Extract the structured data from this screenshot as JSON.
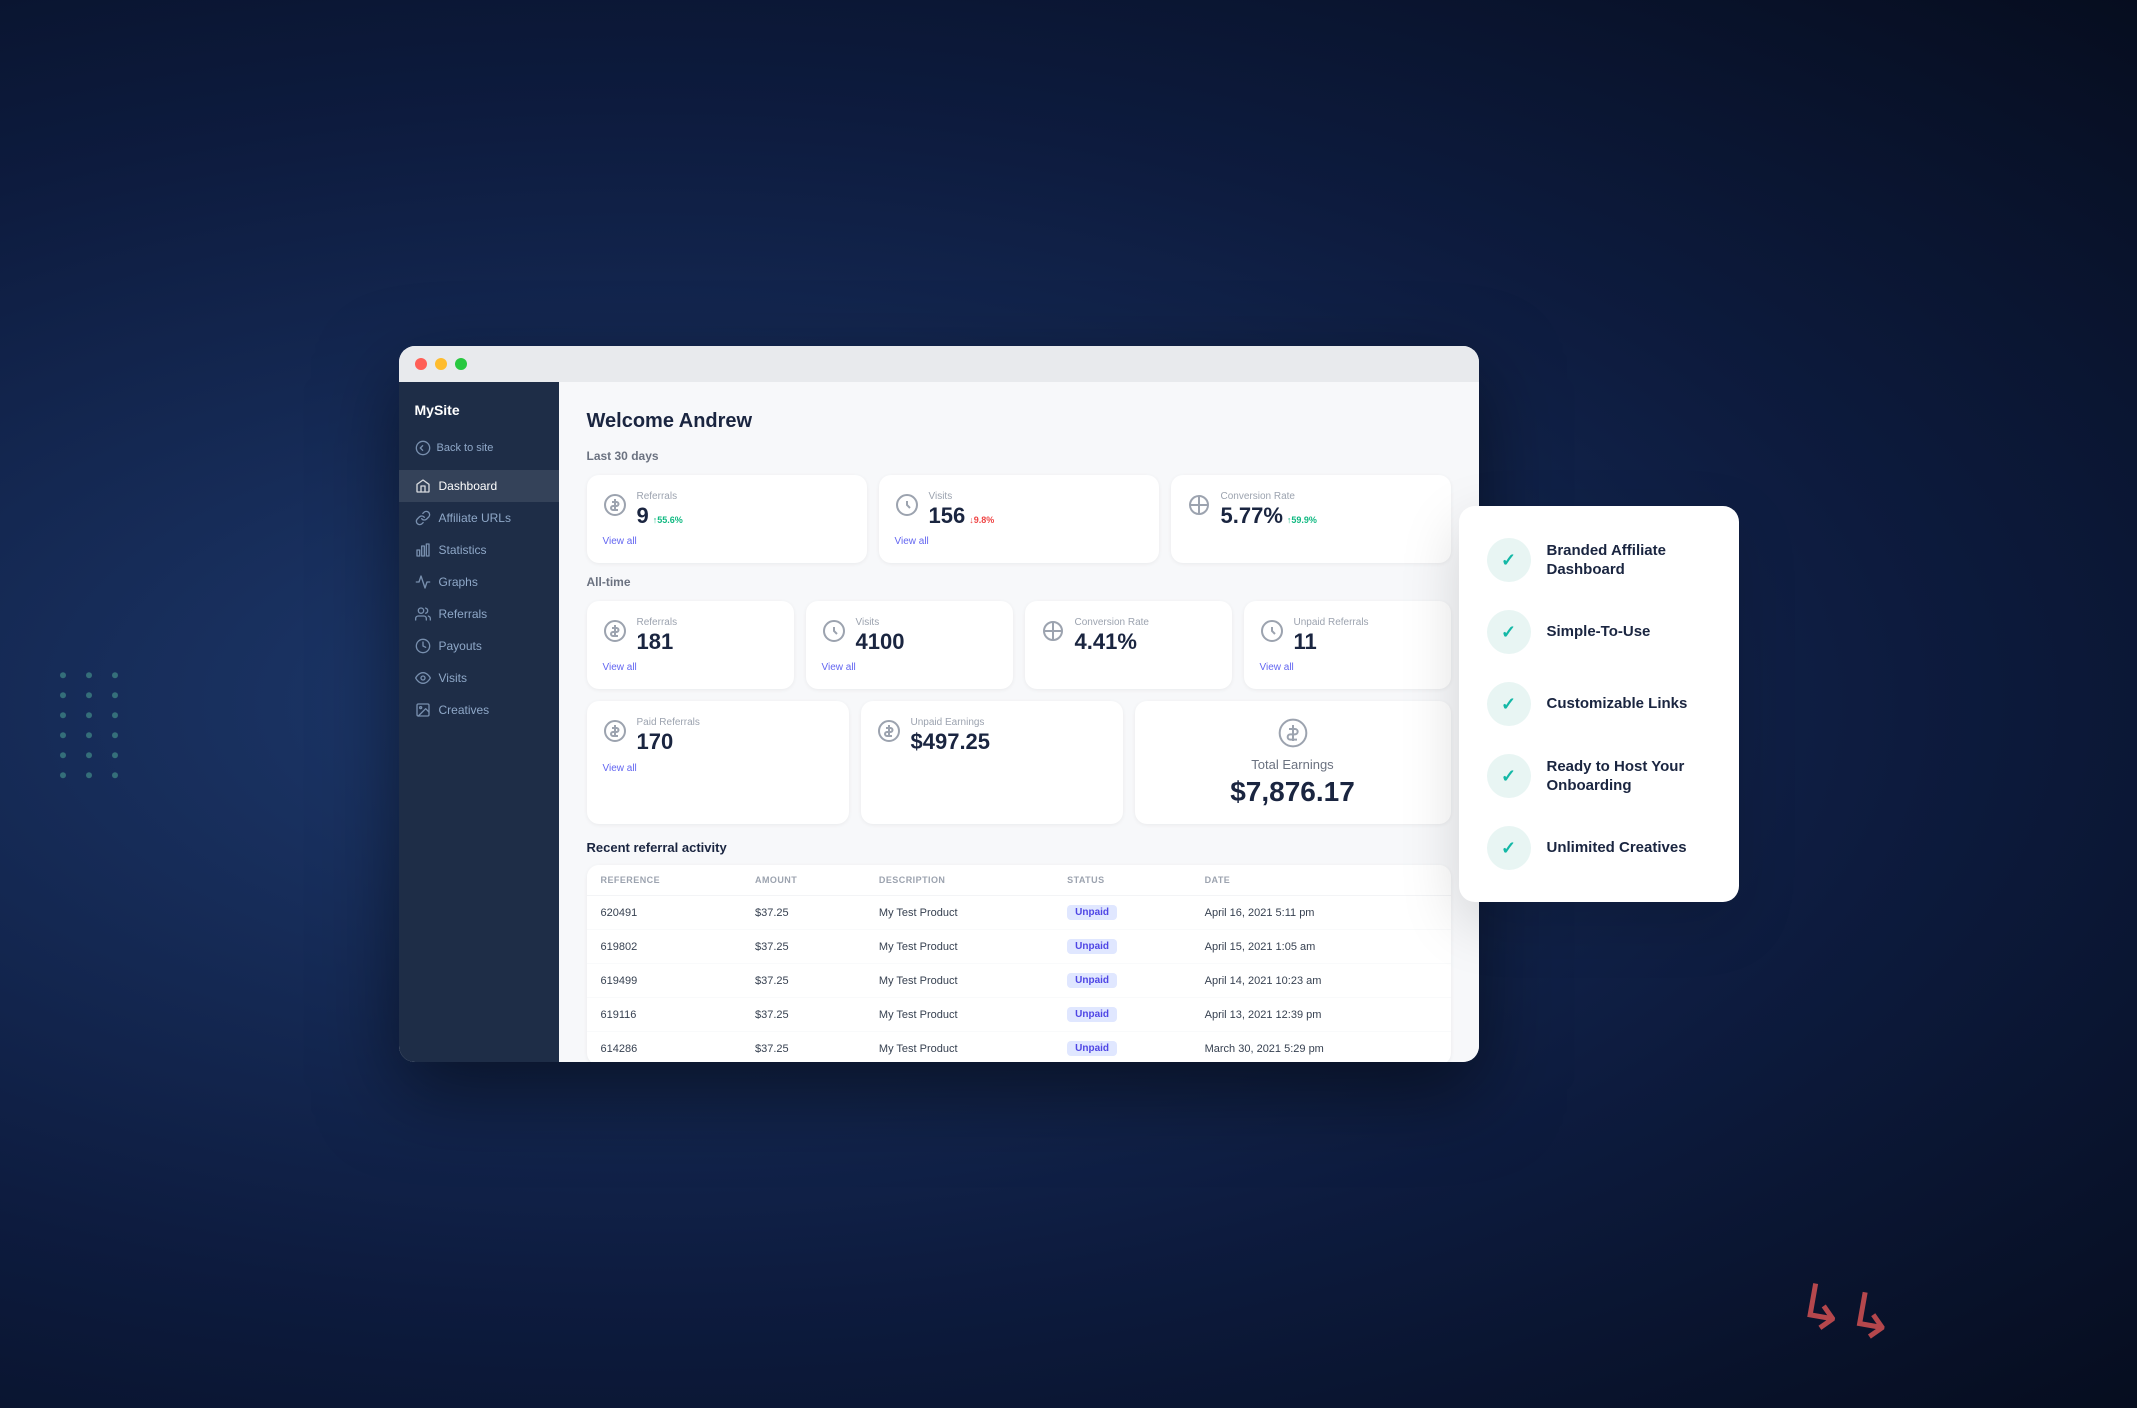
{
  "sidebar": {
    "brand": "MySite",
    "back_label": "Back to site",
    "items": [
      {
        "label": "Dashboard",
        "icon": "home",
        "active": true
      },
      {
        "label": "Affiliate URLs",
        "icon": "link"
      },
      {
        "label": "Statistics",
        "icon": "chart-bar"
      },
      {
        "label": "Graphs",
        "icon": "graph"
      },
      {
        "label": "Referrals",
        "icon": "users"
      },
      {
        "label": "Payouts",
        "icon": "money"
      },
      {
        "label": "Visits",
        "icon": "eye"
      },
      {
        "label": "Creatives",
        "icon": "image"
      }
    ]
  },
  "main": {
    "welcome": "Welcome Andrew",
    "last30_label": "Last 30 days",
    "alltime_label": "All-time",
    "last30_cards": [
      {
        "label": "Referrals",
        "value": "9",
        "badge": "↑55.6%",
        "badge_type": "up",
        "view_all": "View all"
      },
      {
        "label": "Visits",
        "value": "156",
        "badge": "↓9.8%",
        "badge_type": "down",
        "view_all": "View all"
      },
      {
        "label": "Conversion Rate",
        "value": "5.77%",
        "badge": "↑59.9%",
        "badge_type": "up",
        "view_all": ""
      }
    ],
    "alltime_cards": [
      {
        "label": "Referrals",
        "value": "181",
        "view_all": "View all"
      },
      {
        "label": "Visits",
        "value": "4100",
        "view_all": "View all"
      },
      {
        "label": "Conversion Rate",
        "value": "4.41%",
        "view_all": ""
      },
      {
        "label": "Unpaid Referrals",
        "value": "11",
        "view_all": "View all"
      }
    ],
    "bottom_cards": [
      {
        "label": "Paid Referrals",
        "value": "170",
        "view_all": "View all"
      },
      {
        "label": "Unpaid Earnings",
        "value": "$497.25",
        "view_all": ""
      }
    ],
    "total_earnings_label": "Total Earnings",
    "total_earnings_value": "$7,876.17",
    "recent_label": "Recent referral activity",
    "table": {
      "headers": [
        "REFERENCE",
        "AMOUNT",
        "DESCRIPTION",
        "STATUS",
        "DATE"
      ],
      "rows": [
        {
          "ref": "620491",
          "amount": "$37.25",
          "desc": "My Test Product",
          "status": "Unpaid",
          "date": "April 16, 2021 5:11 pm"
        },
        {
          "ref": "619802",
          "amount": "$37.25",
          "desc": "My Test Product",
          "status": "Unpaid",
          "date": "April 15, 2021 1:05 am"
        },
        {
          "ref": "619499",
          "amount": "$37.25",
          "desc": "My Test Product",
          "status": "Unpaid",
          "date": "April 14, 2021 10:23 am"
        },
        {
          "ref": "619116",
          "amount": "$37.25",
          "desc": "My Test Product",
          "status": "Unpaid",
          "date": "April 13, 2021 12:39 pm"
        },
        {
          "ref": "614286",
          "amount": "$37.25",
          "desc": "My Test Product",
          "status": "Unpaid",
          "date": "March 30, 2021 5:29 pm"
        }
      ]
    }
  },
  "features": [
    {
      "label": "Branded Affiliate Dashboard"
    },
    {
      "label": "Simple-To-Use"
    },
    {
      "label": "Customizable Links"
    },
    {
      "label": "Ready to Host Your Onboarding"
    },
    {
      "label": "Unlimited Creatives"
    }
  ]
}
